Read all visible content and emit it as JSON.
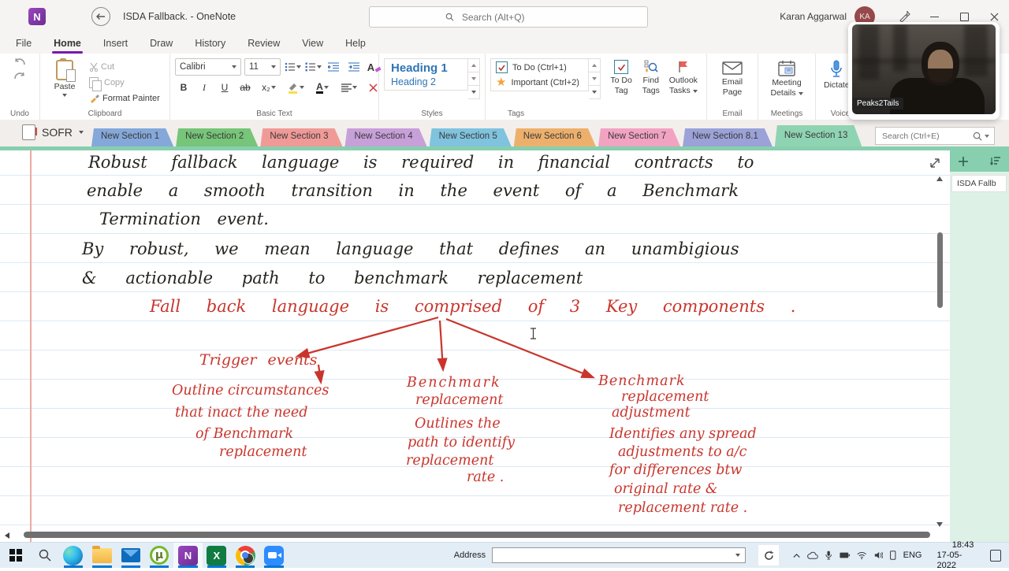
{
  "titlebar": {
    "app_title": "ISDA Fallback.  -  OneNote",
    "search_placeholder": "Search (Alt+Q)",
    "user_name": "Karan Aggarwal",
    "user_initials": "KA"
  },
  "menu": {
    "items": [
      "File",
      "Home",
      "Insert",
      "Draw",
      "History",
      "Review",
      "View",
      "Help"
    ],
    "active": "Home"
  },
  "ribbon": {
    "undo_group": "Undo",
    "clipboard": {
      "paste": "Paste",
      "cut": "Cut",
      "copy": "Copy",
      "format_painter": "Format Painter",
      "group": "Clipboard"
    },
    "basic_text": {
      "font": "Calibri",
      "size": "11",
      "bold": "B",
      "italic": "I",
      "underline": "U",
      "strike": "ab",
      "subscript": "x₂",
      "clear_letter": "A",
      "color_letter": "A",
      "group": "Basic Text"
    },
    "styles": {
      "h1": "Heading 1",
      "h2": "Heading 2",
      "group": "Styles"
    },
    "tags": {
      "todo": "To Do (Ctrl+1)",
      "important": "Important (Ctrl+2)",
      "group": "Tags",
      "todo_tag": "To Do Tag",
      "find_tags": "Find Tags",
      "outlook_tasks": "Outlook Tasks"
    },
    "email": {
      "button": "Email Page",
      "group": "Email"
    },
    "meetings": {
      "button": "Meeting Details",
      "group": "Meetings"
    },
    "voice": {
      "button": "Dictate",
      "group": "Voice"
    }
  },
  "webcam": {
    "label": "Peaks2Tails"
  },
  "section_bar": {
    "notebook": "SOFR",
    "tabs": [
      {
        "label": "New Section 1",
        "color": "#84a8d9"
      },
      {
        "label": "New Section 2",
        "color": "#77c578"
      },
      {
        "label": "New Section 3",
        "color": "#f09a97"
      },
      {
        "label": "New Section 4",
        "color": "#c7a0d9"
      },
      {
        "label": "New Section 5",
        "color": "#7fc3de"
      },
      {
        "label": "New Section 6",
        "color": "#edb06c"
      },
      {
        "label": "New Section 7",
        "color": "#f2a3c2"
      },
      {
        "label": "New Section 8.1",
        "color": "#9aa2d8"
      },
      {
        "label": "New Section 13",
        "color": "#8fd4b2"
      }
    ],
    "active_tab": "New Section 13",
    "overflow": "···",
    "add": "+",
    "search_placeholder": "Search (Ctrl+E)"
  },
  "page_panel": {
    "page": "ISDA Fallb"
  },
  "canvas": {
    "ink_black": "#26251f",
    "ink_red": "#c9352c",
    "black": {
      "l1": "Robust fallback language is required in financial contracts to",
      "l2": "enable a smooth transition in the event of a Benchmark",
      "l3": "Termination event.",
      "l4": "By robust, we mean language that defines an unambigious",
      "l5": "& actionable path to benchmark replacement"
    },
    "red": {
      "heading": "Fall back language is comprised of 3 Key components .",
      "trigger": "Trigger events",
      "left": {
        "l1": "Outline circumstances",
        "l2": "that inact the need",
        "l3": "of Benchmark",
        "l4": "replacement"
      },
      "mid": {
        "l1": "Benchmark",
        "l2": "replacement",
        "l3": "Outlines the",
        "l4": "path to identify",
        "l5": "replacement",
        "l6": "rate ."
      },
      "right": {
        "l1": "Benchmark",
        "l2": "replacement",
        "l3": "adjustment",
        "l4": "Identifies any spread",
        "l5": "adjustments to a/c",
        "l6": "for differences btw",
        "l7": "original rate &",
        "l8": "replacement rate ."
      }
    }
  },
  "taskbar": {
    "address_label": "Address",
    "apps": [
      "edge",
      "file-explorer",
      "mail",
      "utorrent",
      "onenote",
      "excel",
      "chrome",
      "zoom"
    ],
    "tray_icons": [
      "hidden-icons",
      "onedrive",
      "microphone",
      "battery",
      "wifi",
      "volume",
      "your-phone",
      "action-center"
    ],
    "tray": {
      "lang": "ENG",
      "time": "18:43",
      "date": "17-05-2022"
    }
  }
}
